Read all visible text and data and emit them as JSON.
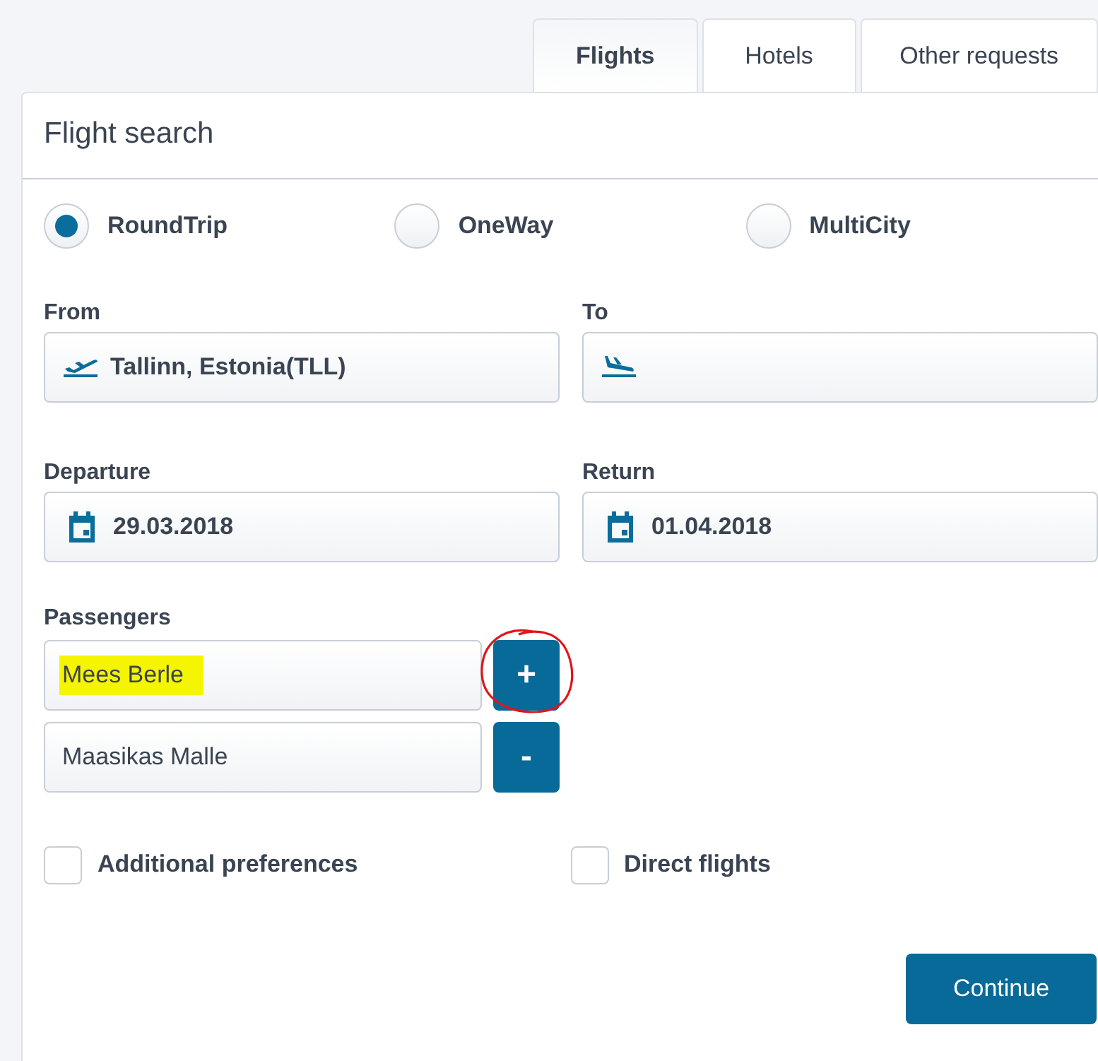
{
  "tabs": [
    {
      "label": "Flights",
      "selected": true
    },
    {
      "label": "Hotels",
      "selected": false
    },
    {
      "label": "Other requests",
      "selected": false
    }
  ],
  "panel_title": "Flight search",
  "trip_types": [
    {
      "label": "RoundTrip",
      "selected": true
    },
    {
      "label": "OneWay",
      "selected": false
    },
    {
      "label": "MultiCity",
      "selected": false
    }
  ],
  "fields": [
    {
      "label": "From",
      "kind": "takeoff",
      "value": "Tallinn, Estonia(TLL)"
    },
    {
      "label": "To",
      "kind": "landing"
    },
    {
      "label": "Departure",
      "kind": "date",
      "value": "29.03.2018"
    },
    {
      "label": "Return",
      "kind": "date",
      "value": "01.04.2018"
    }
  ],
  "passengers_label": "Passengers",
  "passengers": [
    {
      "name": "Mees Berle",
      "highlighted": true,
      "button": "+",
      "circled": true
    },
    {
      "name": "Maasikas Malle",
      "highlighted": false,
      "button": "-",
      "circled": false
    }
  ],
  "options": [
    {
      "label": "Additional preferences",
      "checked": false
    },
    {
      "label": "Direct flights",
      "checked": false
    }
  ],
  "continue_button": "Continue"
}
